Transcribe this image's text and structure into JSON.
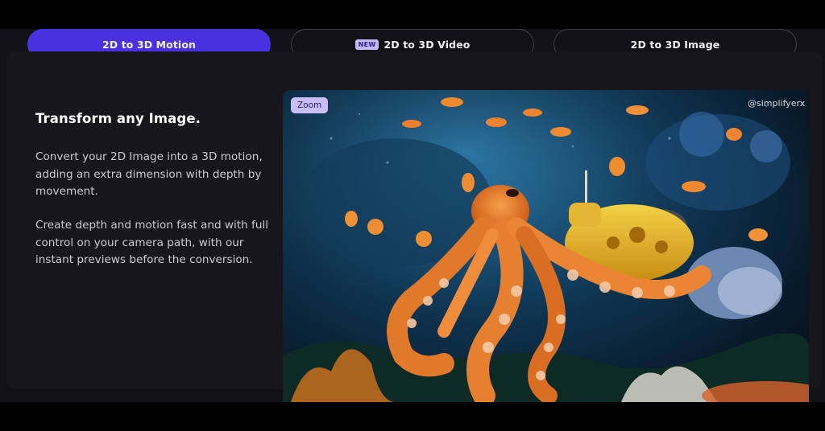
{
  "tabs": [
    {
      "label": "2D to 3D Motion",
      "active": true
    },
    {
      "label": "2D to 3D Video",
      "badge": "NEW",
      "active": false
    },
    {
      "label": "2D to 3D Image",
      "active": false
    }
  ],
  "content": {
    "heading": "Transform any Image.",
    "paragraph1": "Convert your 2D Image into a 3D motion, adding an extra dimension with depth by movement.",
    "paragraph2": "Create depth and motion fast and with full control on your camera path, with our instant previews before the conversion."
  },
  "image": {
    "zoom_label": "Zoom",
    "watermark": "@simplifyerx",
    "description_icon": "underwater-octopus-submarine-image"
  },
  "colors": {
    "accent": "#4a31e0",
    "badge_bg": "#c4b8ff",
    "panel_bg": "#17171b",
    "page_bg": "#000000"
  }
}
